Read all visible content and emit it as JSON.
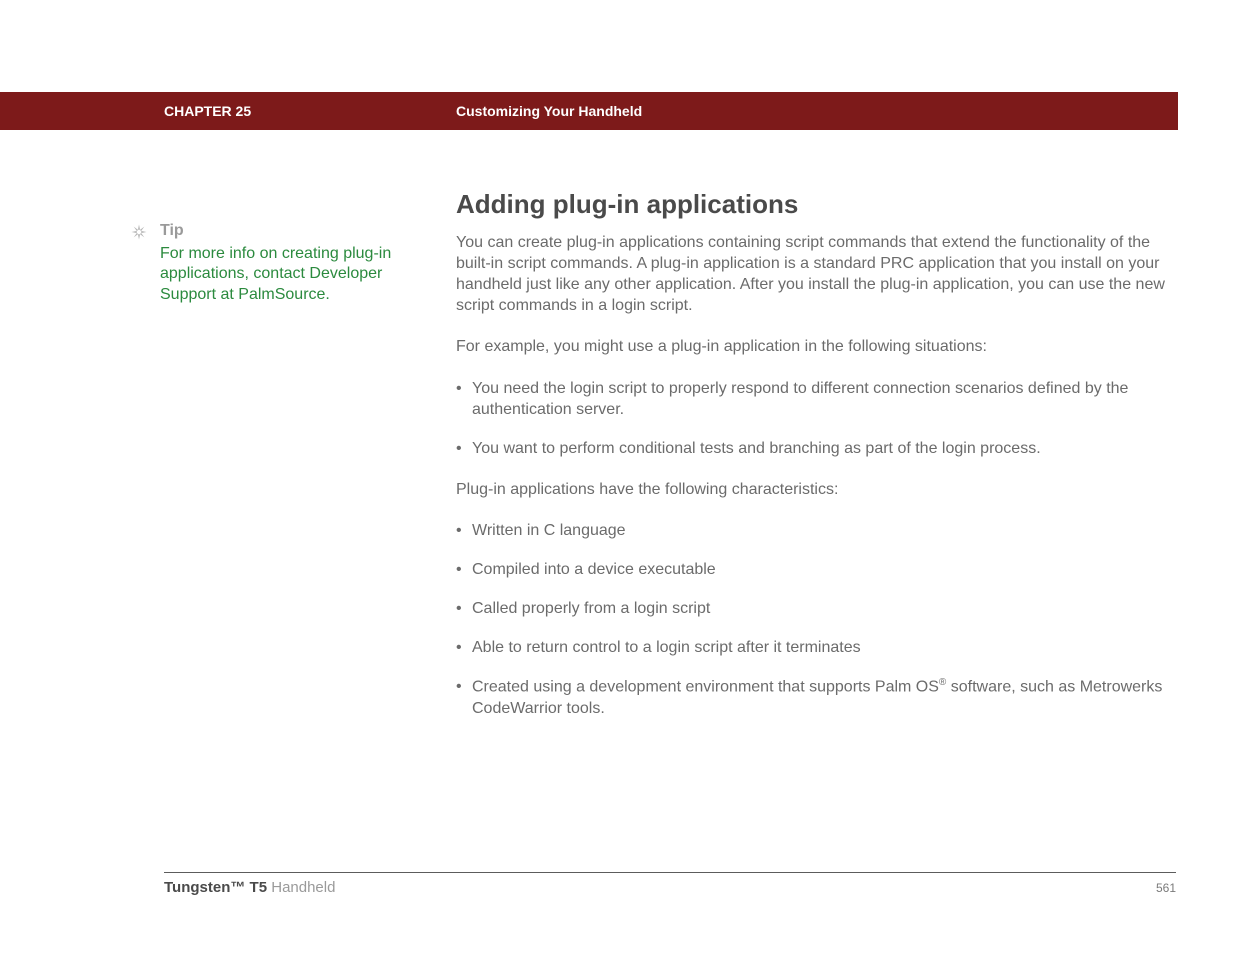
{
  "header": {
    "chapter_label": "CHAPTER 25",
    "chapter_title": "Customizing Your Handheld"
  },
  "sidebar": {
    "tip_label": "Tip",
    "tip_text": "For more info on creating plug-in applications, contact Developer Support at PalmSource."
  },
  "main": {
    "heading": "Adding plug-in applications",
    "intro": "You can create plug-in applications containing script commands that extend the functionality of the built-in script commands. A plug-in application is a standard PRC application that you install on your handheld just like any other application. After you install the plug-in application, you can use the new script commands in a login script.",
    "example_intro": "For example, you might use a plug-in application in the following situations:",
    "situations": [
      "You need the login script to properly respond to different connection scenarios defined by the authentication server.",
      "You want to perform conditional tests and branching as part of the login process."
    ],
    "char_intro": "Plug-in applications have the following characteristics:",
    "characteristics": [
      "Written in C language",
      "Compiled into a device executable",
      "Called properly from a login script",
      "Able to return control to a login script after it terminates"
    ],
    "char_last_prefix": "Created using a development environment that supports Palm OS",
    "char_last_suffix": " software, such as Metrowerks CodeWarrior tools."
  },
  "footer": {
    "product_bold": "Tungsten™ T5",
    "product_rest": " Handheld",
    "page_number": "561"
  }
}
